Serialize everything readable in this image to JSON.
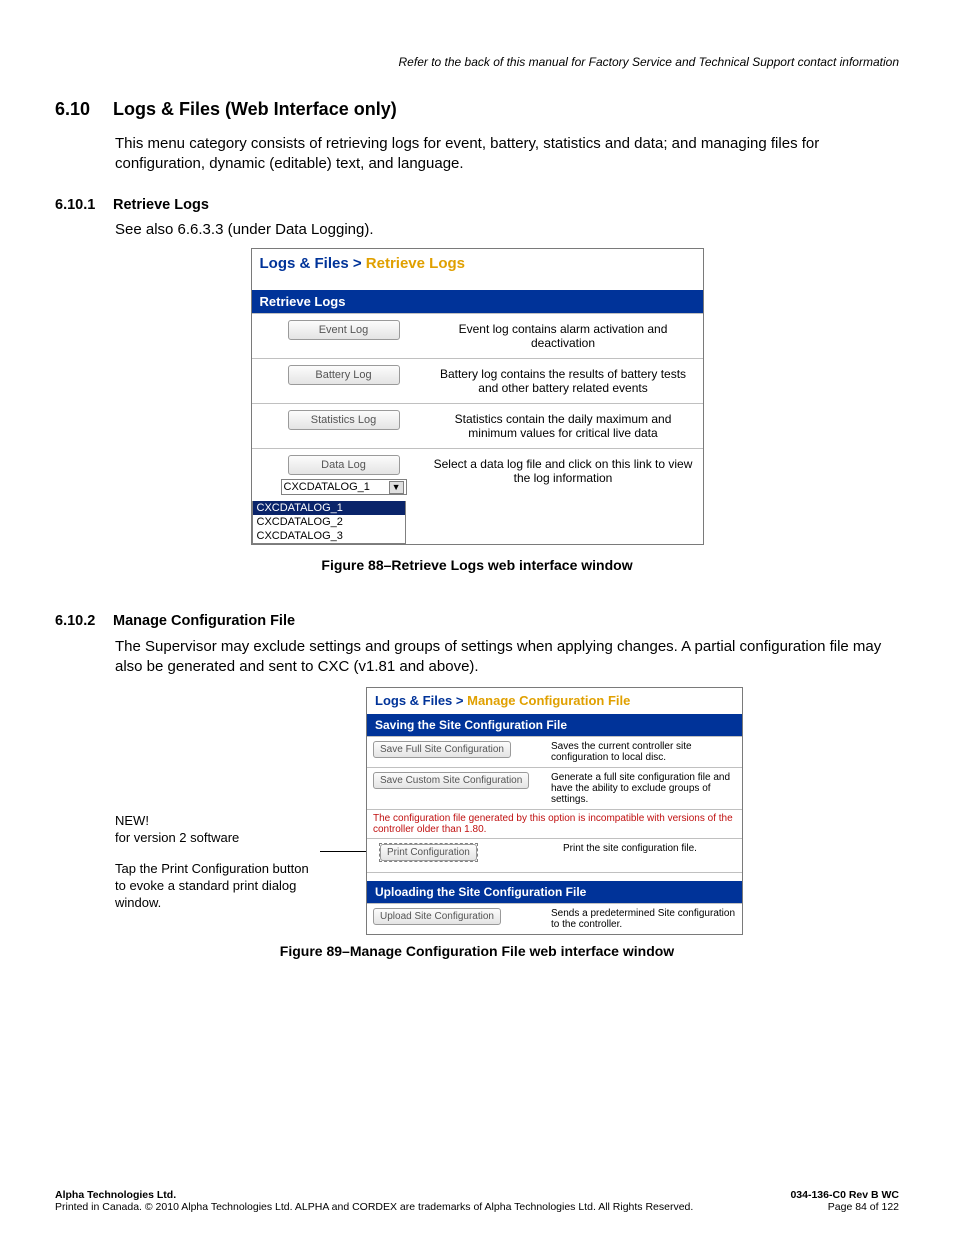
{
  "header_ref": "Refer to the back of this manual for Factory Service and Technical Support contact information",
  "s610": {
    "num": "6.10",
    "title": "Logs & Files (Web Interface only)",
    "para": "This menu category consists of retrieving logs for event, battery, statistics and data; and managing files for configuration, dynamic (editable) text, and language."
  },
  "s6101": {
    "num": "6.10.1",
    "title": "Retrieve Logs",
    "para": "See also 6.6.3.3 (under Data Logging)."
  },
  "fig88": {
    "crumb1": "Logs & Files > ",
    "crumb2": "Retrieve Logs",
    "hdr": "Retrieve Logs",
    "rows": [
      {
        "btn": "Event Log",
        "desc": "Event log contains alarm activation and deactivation"
      },
      {
        "btn": "Battery Log",
        "desc": "Battery log contains the results of battery tests and other battery related events"
      },
      {
        "btn": "Statistics Log",
        "desc": "Statistics contain the daily maximum and minimum values for critical live data"
      },
      {
        "btn": "Data Log",
        "desc": "Select a data log file and click on this link to view the log information"
      }
    ],
    "select_value": "CXCDATALOG_1",
    "options": [
      "CXCDATALOG_1",
      "CXCDATALOG_2",
      "CXCDATALOG_3"
    ],
    "caption": "Figure 88–Retrieve Logs web interface window"
  },
  "s6102": {
    "num": "6.10.2",
    "title": "Manage Configuration File",
    "para": "The Supervisor may exclude settings and groups of settings when applying changes. A partial configuration file may also be generated and sent to CXC (v1.81 and above)."
  },
  "annot": {
    "new": "NEW!",
    "new2": "for version 2 software",
    "tip": "Tap the Print Configuration button to evoke a standard print dialog window."
  },
  "fig89": {
    "crumb1": "Logs & Files > ",
    "crumb2": "Manage Configuration File",
    "hdr1": "Saving the Site Configuration File",
    "r1": {
      "btn": "Save Full Site Configuration",
      "desc": "Saves the current controller site configuration to local disc."
    },
    "r2": {
      "btn": "Save Custom Site Configuration",
      "desc": "Generate a full site configuration file and have the ability to exclude groups of settings."
    },
    "warn": "The configuration file generated by this option is incompatible with versions of the controller older than 1.80.",
    "r3": {
      "btn": "Print Configuration",
      "desc": "Print the site configuration file."
    },
    "hdr2": "Uploading the Site Configuration File",
    "r4": {
      "btn": "Upload Site Configuration",
      "desc": "Sends a predetermined Site configuration to the controller."
    },
    "caption": "Figure 89–Manage Configuration File web interface window"
  },
  "footer": {
    "l1": "Alpha Technologies Ltd.",
    "r1": "034-136-C0  Rev B  WC",
    "l2": "Printed in Canada.  © 2010 Alpha Technologies Ltd.  ALPHA and CORDEX are trademarks of Alpha Technologies Ltd.  All Rights Reserved.",
    "r2": "Page 84 of 122"
  }
}
